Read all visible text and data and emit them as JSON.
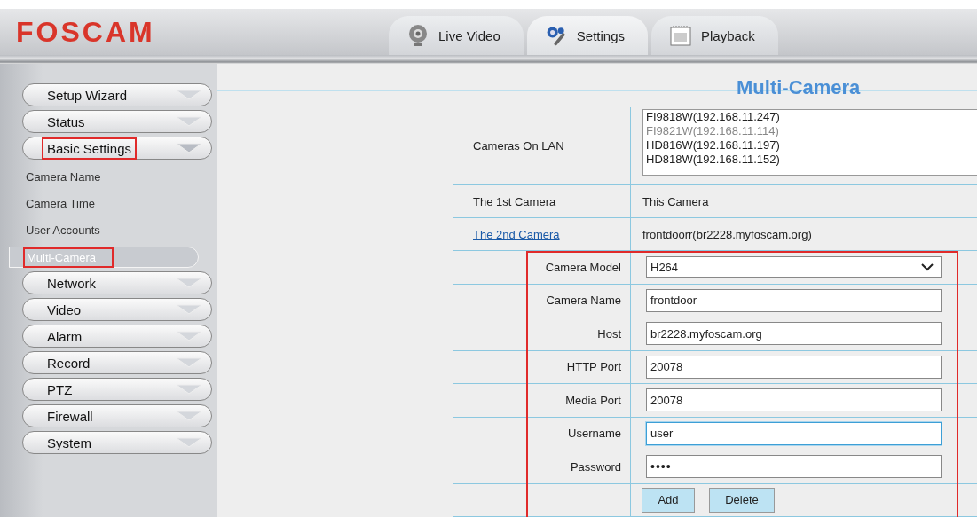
{
  "header": {
    "logo": "FOSCAM",
    "tabs": [
      {
        "label": "Live Video",
        "selected": false
      },
      {
        "label": "Settings",
        "selected": true
      },
      {
        "label": "Playback",
        "selected": false
      }
    ]
  },
  "sidebar": {
    "items": [
      {
        "label": "Setup Wizard",
        "expanded": false,
        "highlighted": false
      },
      {
        "label": "Status",
        "expanded": false,
        "highlighted": false
      },
      {
        "label": "Basic Settings",
        "expanded": true,
        "highlighted": true,
        "children": [
          {
            "label": "Camera Name",
            "selected": false,
            "highlighted": false
          },
          {
            "label": "Camera Time",
            "selected": false,
            "highlighted": false
          },
          {
            "label": "User Accounts",
            "selected": false,
            "highlighted": false
          },
          {
            "label": "Multi-Camera",
            "selected": true,
            "highlighted": true
          }
        ]
      },
      {
        "label": "Network",
        "expanded": false,
        "highlighted": false
      },
      {
        "label": "Video",
        "expanded": false,
        "highlighted": false
      },
      {
        "label": "Alarm",
        "expanded": false,
        "highlighted": false
      },
      {
        "label": "Record",
        "expanded": false,
        "highlighted": false
      },
      {
        "label": "PTZ",
        "expanded": false,
        "highlighted": false
      },
      {
        "label": "Firewall",
        "expanded": false,
        "highlighted": false
      },
      {
        "label": "System",
        "expanded": false,
        "highlighted": false
      }
    ]
  },
  "page": {
    "title": "Multi-Camera",
    "lan": {
      "label": "Cameras On LAN",
      "cameras": [
        {
          "text": "FI9818W(192.168.11.247)",
          "disabled": false
        },
        {
          "text": "FI9821W(192.168.11.114)",
          "disabled": true
        },
        {
          "text": "HD816W(192.168.11.197)",
          "disabled": false
        },
        {
          "text": "HD818W(192.168.11.152)",
          "disabled": false
        }
      ]
    },
    "rows": [
      {
        "label": "The 1st Camera",
        "value": "This Camera",
        "kind": "text"
      },
      {
        "label": "The 2nd Camera",
        "value": "frontdoorr(br2228.myfoscam.org)",
        "kind": "link"
      }
    ],
    "form": {
      "highlighted": true,
      "fields": [
        {
          "label": "Camera Model",
          "value": "H264",
          "kind": "select",
          "focused": false
        },
        {
          "label": "Camera Name",
          "value": "frontdoor",
          "kind": "text",
          "focused": false
        },
        {
          "label": "Host",
          "value": "br2228.myfoscam.org",
          "kind": "text",
          "focused": false
        },
        {
          "label": "HTTP Port",
          "value": "20078",
          "kind": "text",
          "focused": false
        },
        {
          "label": "Media Port",
          "value": "20078",
          "kind": "text",
          "focused": false
        },
        {
          "label": "Username",
          "value": "user",
          "kind": "text",
          "focused": true
        },
        {
          "label": "Password",
          "value": "••••",
          "kind": "password",
          "focused": false
        }
      ],
      "buttons": [
        "Add",
        "Delete"
      ]
    }
  }
}
